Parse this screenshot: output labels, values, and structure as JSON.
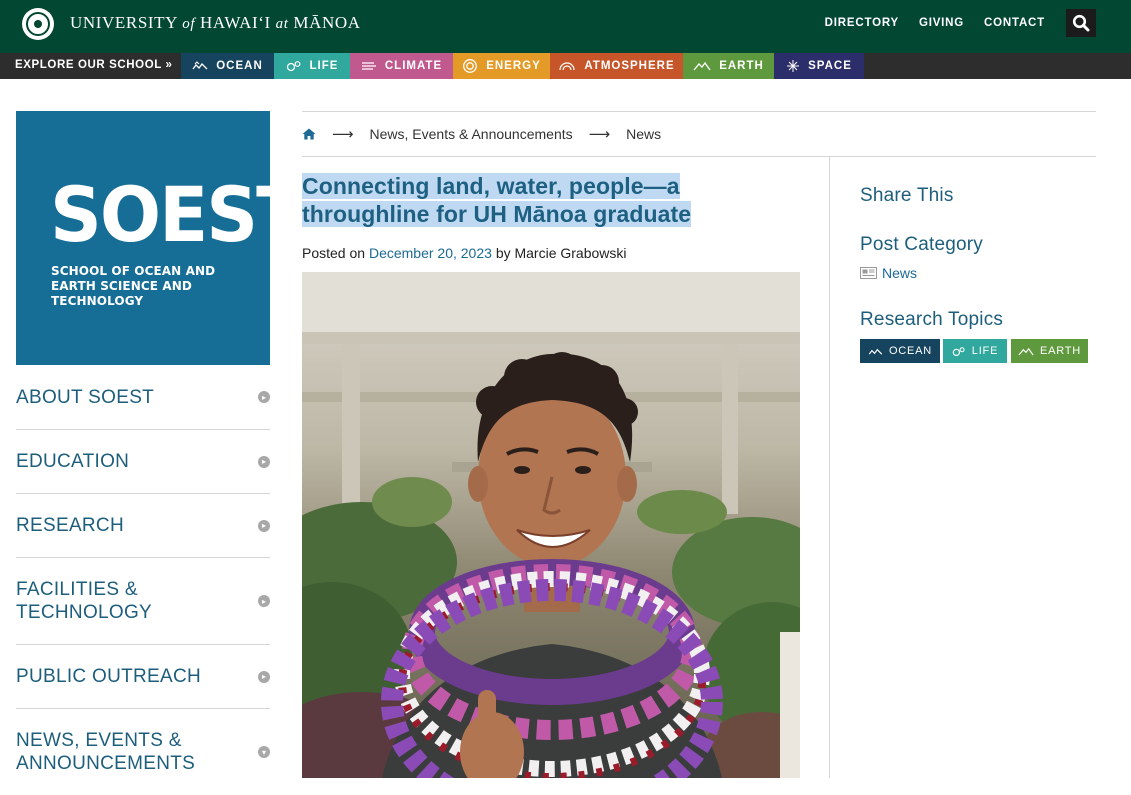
{
  "header": {
    "uh_name_part1": "UNIVERSITY",
    "uh_name_of": "of",
    "uh_name_part2": "HAWAI‘I",
    "uh_name_at": "at",
    "uh_name_part3": "MĀNOA",
    "links": [
      "DIRECTORY",
      "GIVING",
      "CONTACT"
    ],
    "search_icon": "search-icon"
  },
  "explore": {
    "label": "EXPLORE OUR SCHOOL »",
    "tabs": [
      {
        "label": "OCEAN",
        "color": "#16445f",
        "icon": "waves-icon"
      },
      {
        "label": "LIFE",
        "color": "#31a89d",
        "icon": "cells-icon"
      },
      {
        "label": "CLIMATE",
        "color": "#c05a8e",
        "icon": "wind-icon"
      },
      {
        "label": "ENERGY",
        "color": "#e39a26",
        "icon": "sun-icon"
      },
      {
        "label": "ATMOSPHERE",
        "color": "#c6562a",
        "icon": "rainbow-icon"
      },
      {
        "label": "EARTH",
        "color": "#5e9a3d",
        "icon": "mountain-icon"
      },
      {
        "label": "SPACE",
        "color": "#2c2d6b",
        "icon": "star-icon"
      }
    ]
  },
  "logo": {
    "word": "SOEST",
    "subtitle": "SCHOOL OF OCEAN AND EARTH SCIENCE AND TECHNOLOGY"
  },
  "leftnav": {
    "items": [
      {
        "label": "ABOUT SOEST",
        "state": "collapsed"
      },
      {
        "label": "EDUCATION",
        "state": "collapsed"
      },
      {
        "label": "RESEARCH",
        "state": "collapsed"
      },
      {
        "label": "FACILITIES & TECHNOLOGY",
        "state": "collapsed"
      },
      {
        "label": "PUBLIC OUTREACH",
        "state": "collapsed"
      },
      {
        "label": "NEWS, EVENTS & ANNOUNCEMENTS",
        "state": "expanded"
      }
    ]
  },
  "breadcrumb": {
    "home_icon": "home-icon",
    "items": [
      "News, Events & Announcements",
      "News"
    ]
  },
  "article": {
    "title": "Connecting land, water, people—a throughline for UH Mānoa graduate",
    "posted_prefix": "Posted on",
    "date": "December 20, 2023",
    "by_text": "by Marcie Grabowski"
  },
  "sidebar": {
    "share_heading": "Share This",
    "category_heading": "Post Category",
    "category_link": "News",
    "topics_heading": "Research Topics",
    "topics": [
      {
        "label": "OCEAN",
        "color": "#16445f"
      },
      {
        "label": "LIFE",
        "color": "#31a89d"
      },
      {
        "label": "EARTH",
        "color": "#5e9a3d"
      }
    ]
  },
  "colors": {
    "uh_green": "#024731",
    "explore_bar": "#2d2d2d",
    "soest_blue": "#166e97",
    "link_blue": "#1d6a94",
    "title_highlight": "#bfd9f2"
  }
}
